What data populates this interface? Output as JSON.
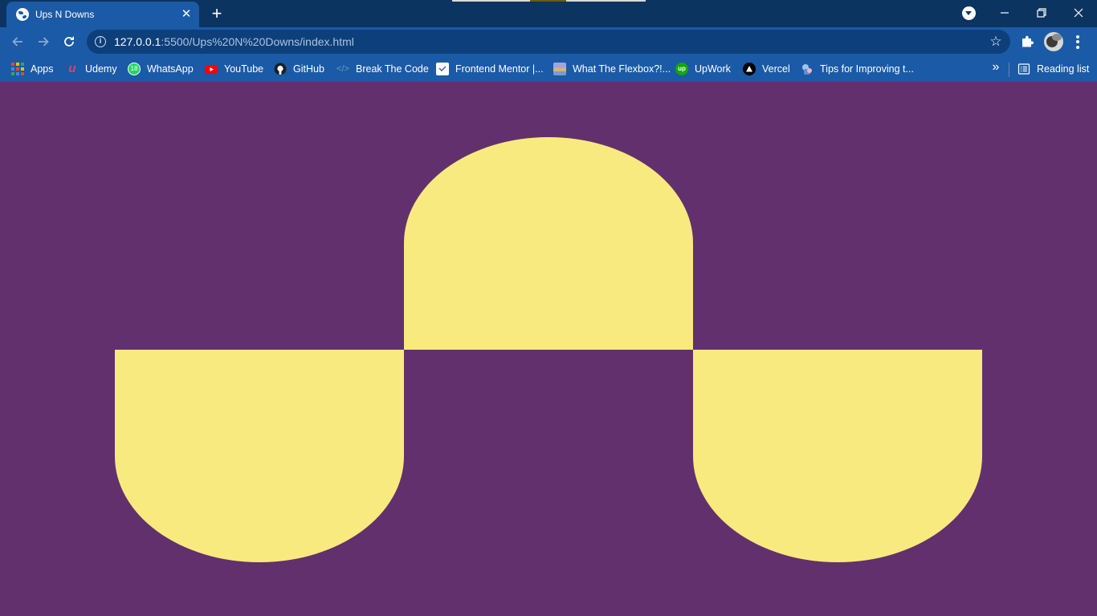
{
  "browser": {
    "tab": {
      "title": "Ups N Downs",
      "close_label": "✕"
    },
    "new_tab_label": "+",
    "window_controls": {
      "minimize": "–",
      "restore": "❐",
      "close": "✕"
    },
    "address_bar": {
      "host": "127.0.0.1",
      "rest": ":5500/Ups%20N%20Downs/index.html"
    },
    "bookmarks": [
      {
        "label": "Apps",
        "icon": "apps-grid-icon"
      },
      {
        "label": "Udemy",
        "icon": "udemy-icon"
      },
      {
        "label": "WhatsApp",
        "icon": "whatsapp-icon",
        "badge": "18"
      },
      {
        "label": "YouTube",
        "icon": "youtube-icon"
      },
      {
        "label": "GitHub",
        "icon": "github-icon"
      },
      {
        "label": "Break The Code",
        "icon": "code-icon"
      },
      {
        "label": "Frontend Mentor |...",
        "icon": "frontend-mentor-icon"
      },
      {
        "label": "What The Flexbox?!...",
        "icon": "flexbox-icon"
      },
      {
        "label": "UpWork",
        "icon": "upwork-icon"
      },
      {
        "label": "Vercel",
        "icon": "vercel-icon"
      },
      {
        "label": "Tips for Improving t...",
        "icon": "article-icon"
      }
    ],
    "overflow_label": "»",
    "reading_list_label": "Reading list"
  },
  "page": {
    "background_color": "#62306d",
    "shape_color": "#f8ea7e"
  }
}
